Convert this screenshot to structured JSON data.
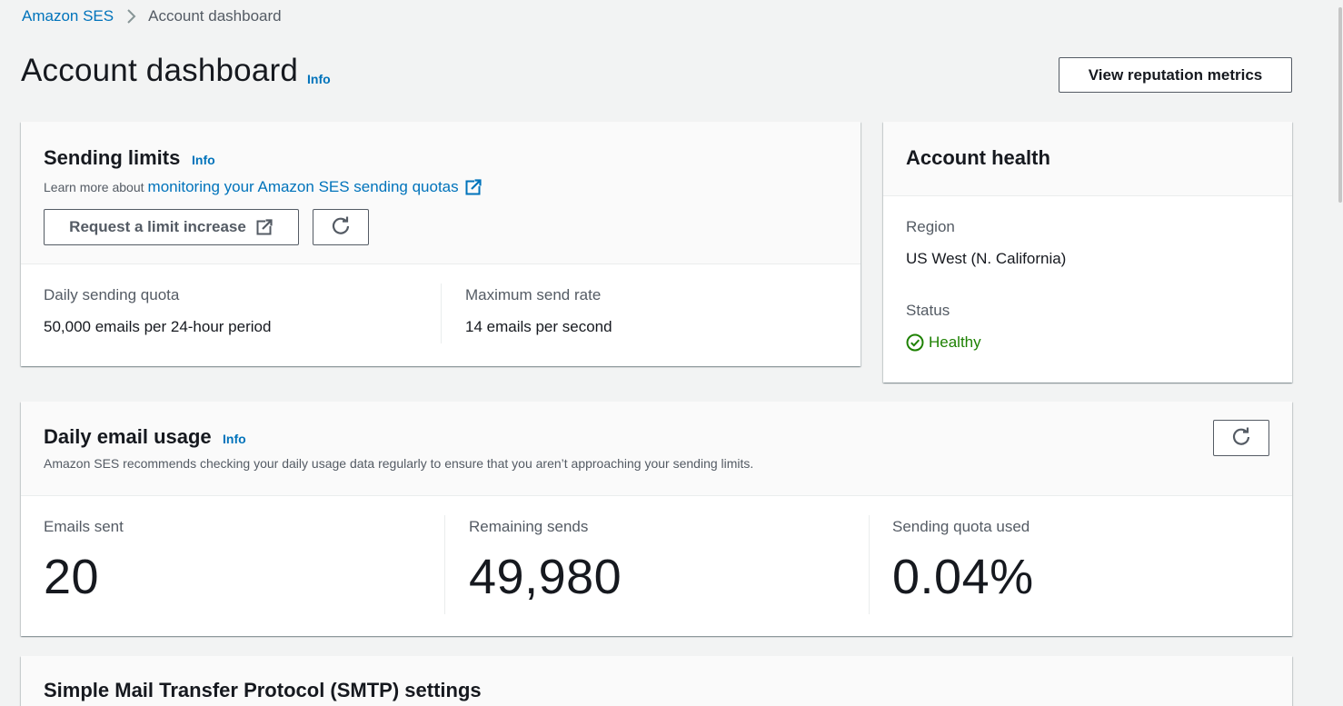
{
  "breadcrumb": {
    "root": "Amazon SES",
    "current": "Account dashboard"
  },
  "header": {
    "title": "Account dashboard",
    "info": "Info",
    "reputation_button": "View reputation metrics"
  },
  "sending_limits": {
    "title": "Sending limits",
    "info": "Info",
    "learn_prefix": "Learn more about",
    "learn_link": "monitoring your Amazon SES sending quotas",
    "request_button": "Request a limit increase",
    "daily_quota_label": "Daily sending quota",
    "daily_quota_value": "50,000 emails per 24-hour period",
    "max_rate_label": "Maximum send rate",
    "max_rate_value": "14 emails per second"
  },
  "account_health": {
    "title": "Account health",
    "region_label": "Region",
    "region_value": "US West (N. California)",
    "status_label": "Status",
    "status_value": "Healthy"
  },
  "daily_usage": {
    "title": "Daily email usage",
    "info": "Info",
    "description": "Amazon SES recommends checking your daily usage data regularly to ensure that you aren’t approaching your sending limits.",
    "metrics": [
      {
        "label": "Emails sent",
        "value": "20"
      },
      {
        "label": "Remaining sends",
        "value": "49,980"
      },
      {
        "label": "Sending quota used",
        "value": "0.04%"
      }
    ]
  },
  "smtp": {
    "title": "Simple Mail Transfer Protocol (SMTP) settings"
  },
  "colors": {
    "link": "#0073bb",
    "success": "#1d8102",
    "background": "#f2f3f3",
    "text": "#16191f",
    "muted": "#545b64"
  },
  "icons": [
    "chevron-right-icon",
    "external-link-icon",
    "refresh-icon",
    "check-circle-icon"
  ]
}
